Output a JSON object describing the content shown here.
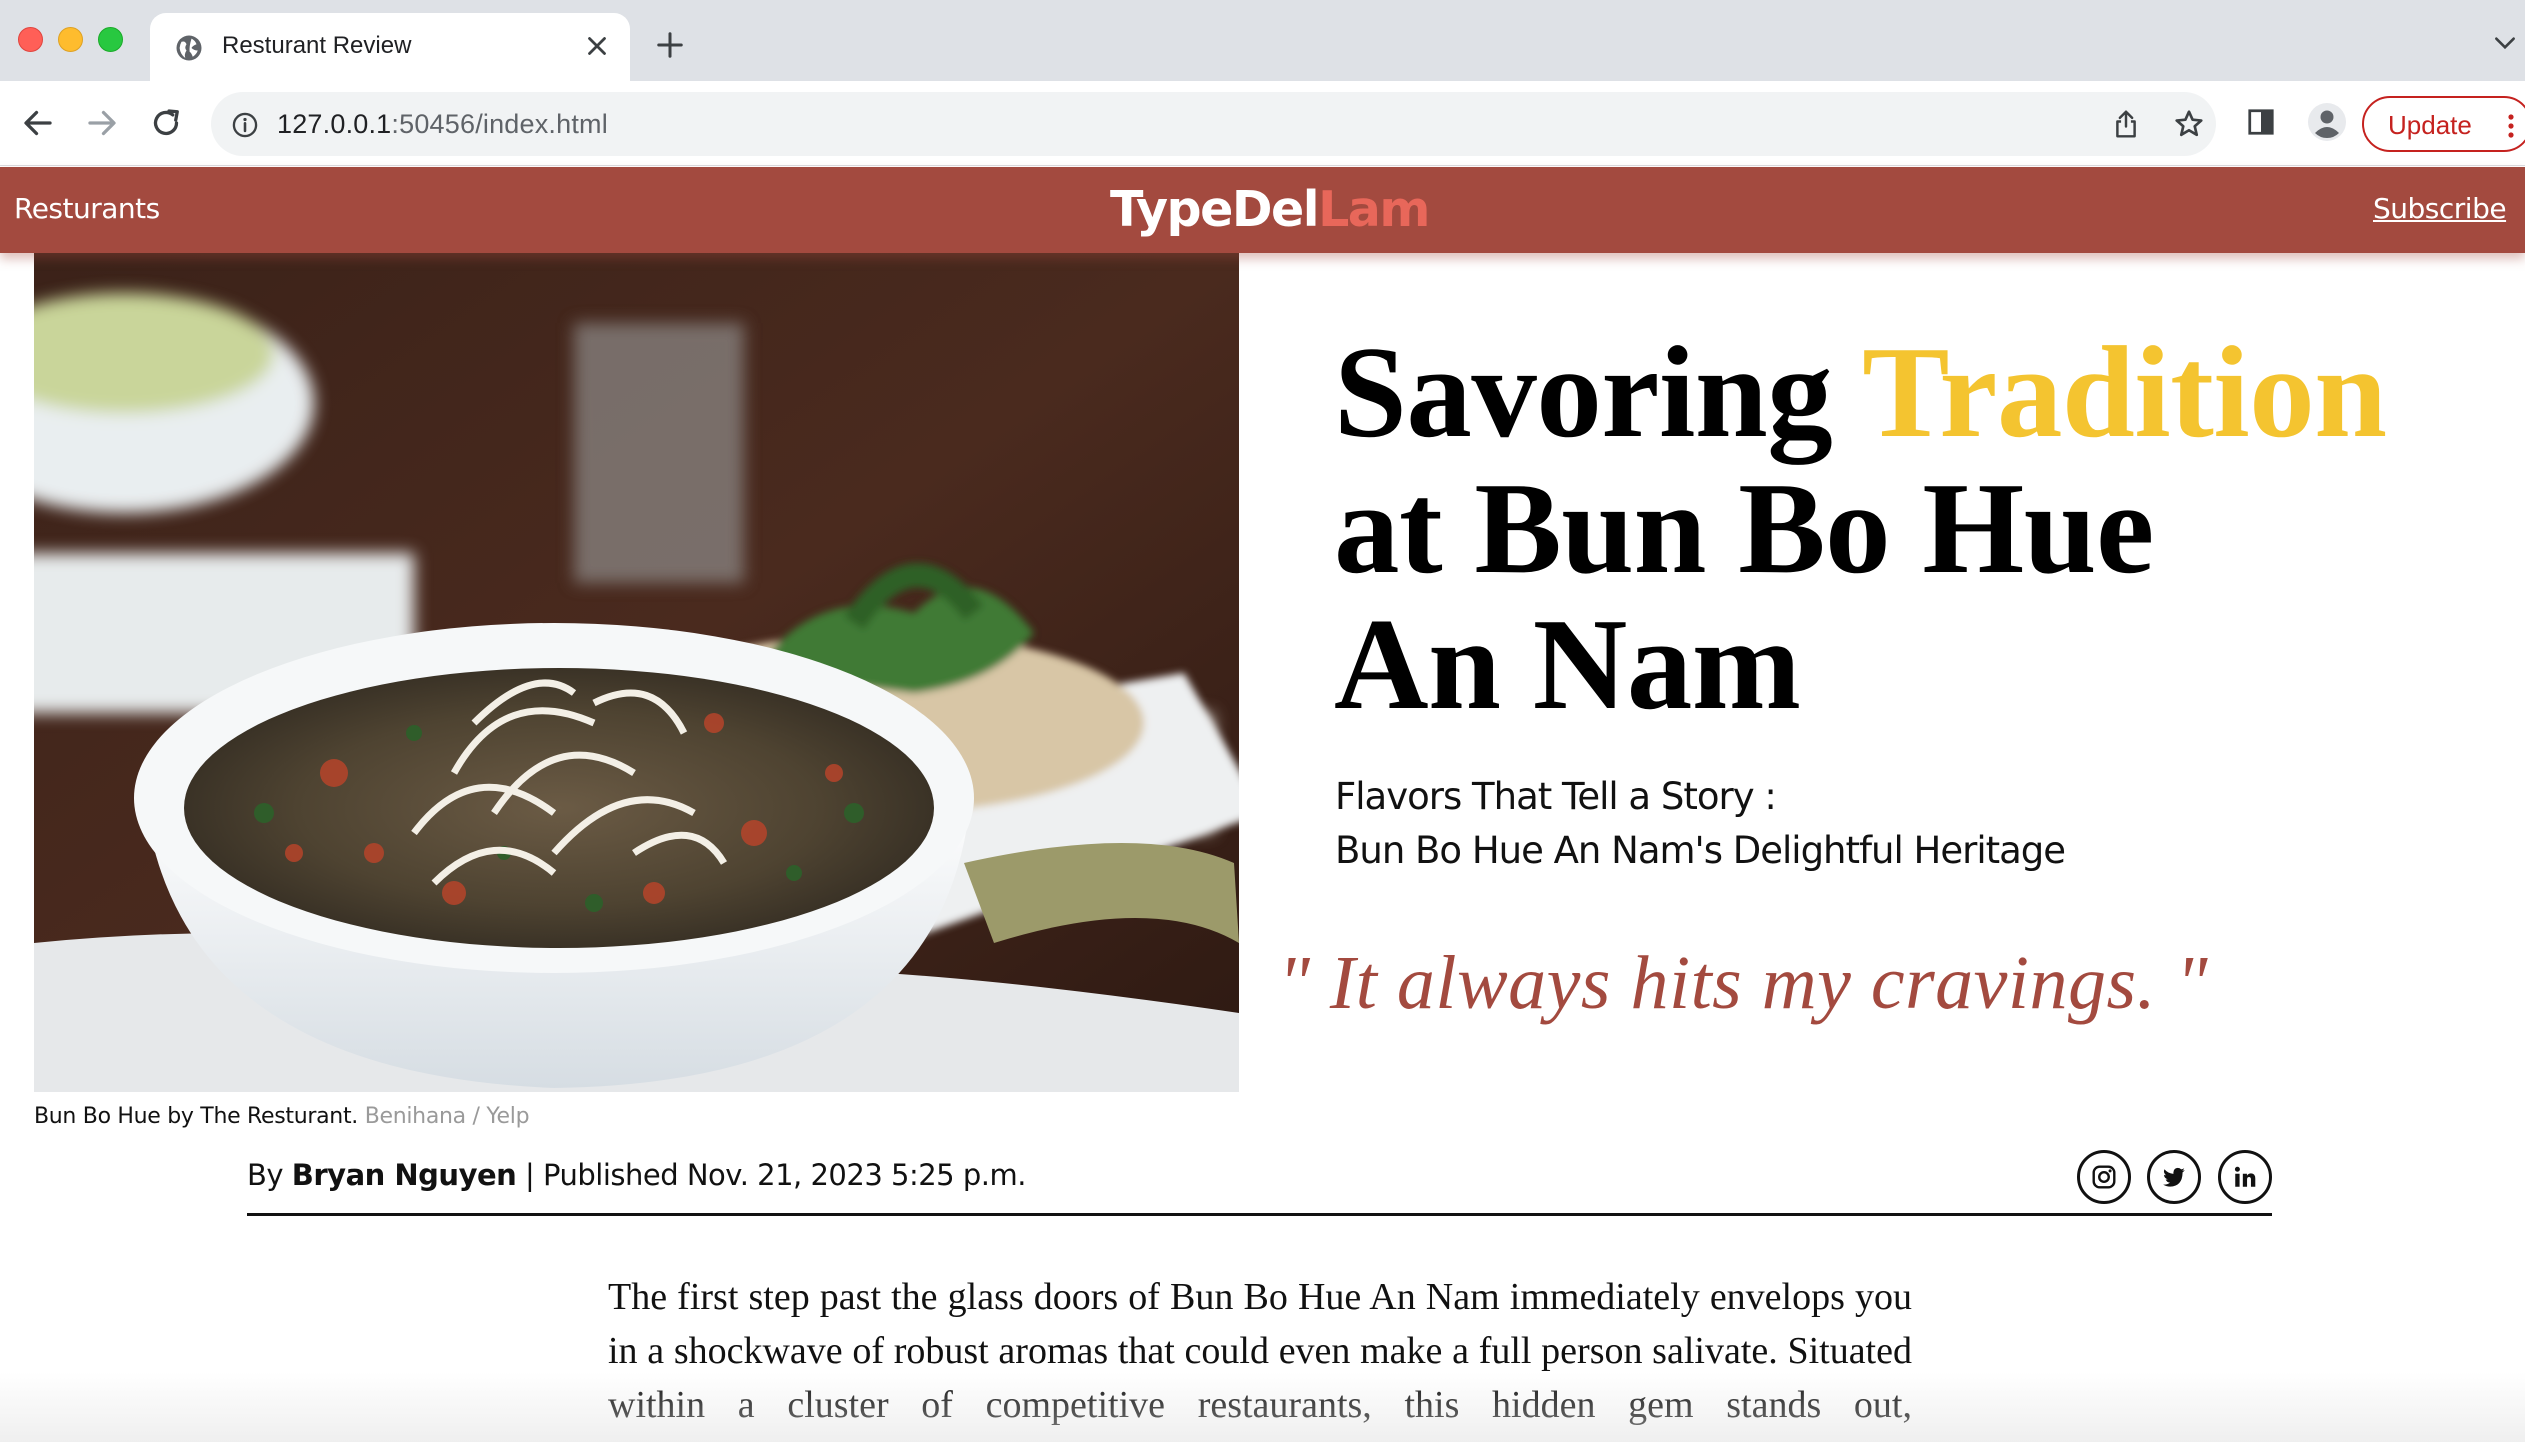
{
  "browser": {
    "tab_title": "Resturant Review",
    "url_host": "127.0.0.1",
    "url_rest": ":50456/index.html",
    "update_label": "Update",
    "icons": [
      "globe-icon",
      "close-icon",
      "plus-icon",
      "chevron-down-icon",
      "back-arrow-icon",
      "forward-arrow-icon",
      "reload-icon",
      "info-icon",
      "share-icon",
      "star-icon",
      "side-panel-icon",
      "profile-icon",
      "kebab-menu-icon"
    ]
  },
  "site": {
    "nav_left": "Resturants",
    "logo_main": "TypeDel",
    "logo_accent": "Lam",
    "subscribe": "Subscribe",
    "header_color": "#a34a3f",
    "logo_accent_color": "#e8675a"
  },
  "hero": {
    "caption": "Bun Bo Hue by The Resturant.",
    "caption_credit": "Benihana / Yelp",
    "headline_part1": "Savoring",
    "headline_highlight": "Tradition",
    "headline_line2": "at Bun Bo Hue",
    "headline_line3": "An Nam",
    "highlight_color": "#f4c430",
    "subhead_line1": "Flavors That Tell a Story :",
    "subhead_line2": "Bun Bo Hue An Nam's Delightful Heritage",
    "quote": "\" It always hits my cravings. \""
  },
  "byline": {
    "by": "By",
    "author": "Bryan Nguyen",
    "separator": "|",
    "published_label": "Published",
    "date": "Nov. 21, 2023 5:25 p.m.",
    "social_icons": [
      "instagram-icon",
      "twitter-icon",
      "linkedin-icon"
    ]
  },
  "article": {
    "paragraph": "The first step past the glass doors of Bun Bo Hue An Nam immediately envelops you in a shockwave of robust aromas that could even make a full person salivate. Situated within a cluster of competitive restaurants, this hidden gem stands out,"
  }
}
